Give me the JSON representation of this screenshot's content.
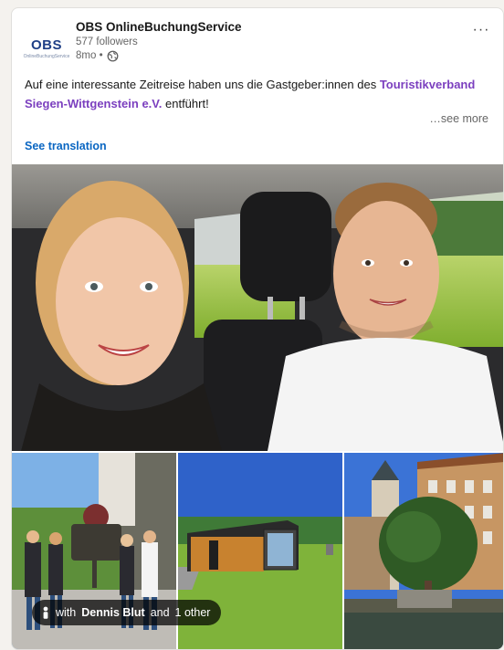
{
  "post": {
    "actor": {
      "logo_text": "OBS",
      "logo_sub": "OnlineBuchungService",
      "name": "OBS OnlineBuchungService",
      "followers": "577 followers",
      "time": "8mo •",
      "visibility_icon": "globe-icon"
    },
    "menu_icon": "more-horizontal-icon",
    "menu_label": "···",
    "commentary": {
      "text_before": "Auf eine interessante Zeitreise haben uns die Gastgeber:innen des ",
      "org_name": "Touristikverband Siegen-Wittgenstein e.V.",
      "text_after": " entführt!"
    },
    "see_more": "…see more",
    "see_translation": "See translation",
    "images": [
      {
        "name": "selfie-in-car-photo"
      },
      {
        "name": "group-at-sign-photo"
      },
      {
        "name": "tiny-house-photo"
      },
      {
        "name": "castle-with-tree-photo"
      }
    ],
    "tag": {
      "icon": "person-icon",
      "prefix": "with",
      "person": "Dennis Blut",
      "joiner": "and",
      "others": "1 other"
    },
    "colors": {
      "link": "#0a66c2",
      "org_link": "#7b3fbf",
      "text": "#191919",
      "secondary": "#666666"
    }
  }
}
